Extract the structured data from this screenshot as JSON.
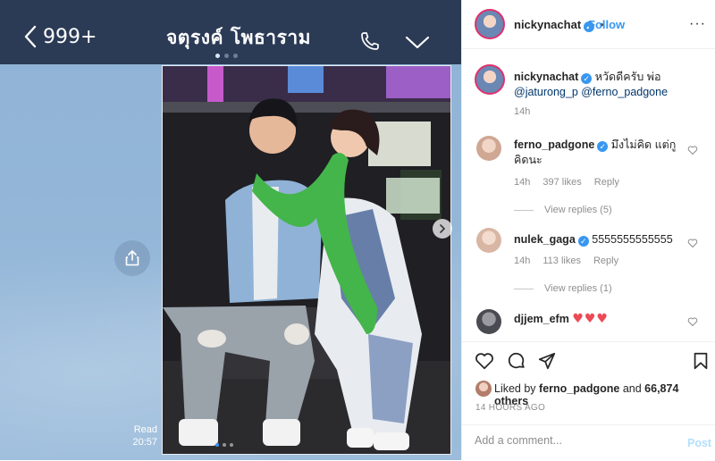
{
  "chat": {
    "back_count": "999+",
    "title": "จตุรงค์ โพธาราม",
    "read_label": "Read",
    "read_time": "20:57"
  },
  "instagram": {
    "header": {
      "username": "nickynachat",
      "separator": "•",
      "follow_label": "Follow",
      "more": "···"
    },
    "caption": {
      "username": "nickynachat",
      "text": "หวัดดีครับ พ่อ",
      "mentions": "@jaturong_p @ferno_padgone",
      "time": "14h"
    },
    "comments": [
      {
        "username": "ferno_padgone",
        "text": "มึงไม่คิด แต่กูคิดนะ",
        "time": "14h",
        "likes": "397 likes",
        "reply": "Reply",
        "view_replies": "View replies (5)"
      },
      {
        "username": "nulek_gaga",
        "text": "5555555555555",
        "time": "14h",
        "likes": "113 likes",
        "reply": "Reply",
        "view_replies": "View replies (1)"
      },
      {
        "username": "djjem_efm",
        "text": "♥♥♥"
      }
    ],
    "liked_prefix": "Liked by",
    "liked_user": "ferno_padgone",
    "liked_and": "and",
    "liked_count": "66,874 others",
    "timestamp": "14 HOURS AGO",
    "add_comment_placeholder": "Add a comment...",
    "post_label": "Post",
    "colors": {
      "accent": "#3897f0",
      "hearts": "#ed4956",
      "topbar": "#2b3a55"
    }
  }
}
